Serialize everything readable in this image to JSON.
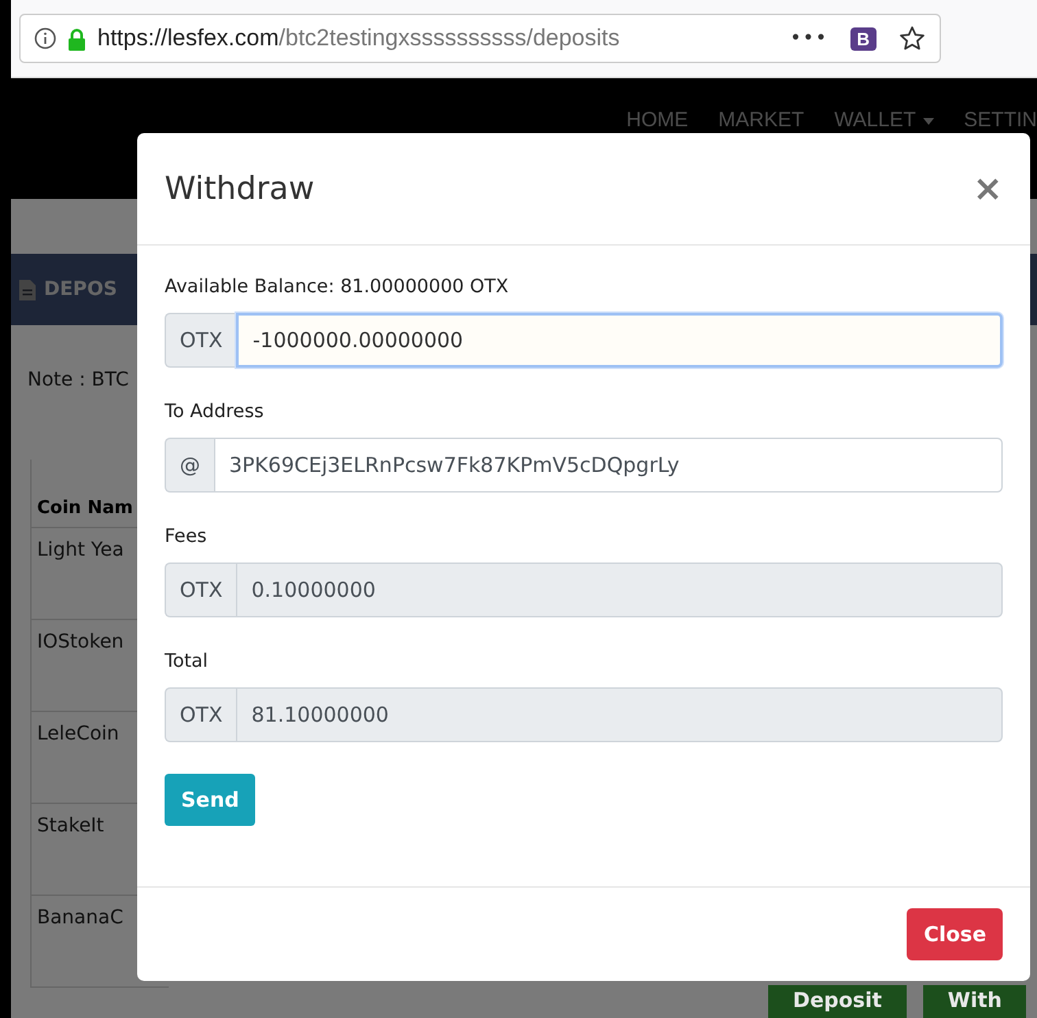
{
  "browser": {
    "url_host": "https://lesfex.com",
    "url_path": "/btc2testingxssssssssss/deposits",
    "more": "•••",
    "extension": "B"
  },
  "nav": [
    {
      "label": "HOME",
      "dropdown": false
    },
    {
      "label": "MARKET",
      "dropdown": false
    },
    {
      "label": "WALLET",
      "dropdown": true
    },
    {
      "label": "SETTIN",
      "dropdown": false
    }
  ],
  "page": {
    "section_title": "DEPOS",
    "note": "Note : BTC",
    "table": {
      "header": "Coin Nam",
      "rows": [
        "Light Yea",
        "IOStoken",
        "LeleCoin",
        "StakeIt",
        "BananaC"
      ]
    },
    "row_buttons": [
      "Deposit",
      "With"
    ]
  },
  "modal": {
    "title": "Withdraw",
    "close_icon": "×",
    "fields": [
      {
        "label": "Available Balance: 81.00000000 OTX",
        "addon": "OTX",
        "value": "-1000000.00000000",
        "focused": true,
        "readonly": false
      },
      {
        "label": "To Address",
        "addon": "@",
        "value": "3PK69CEj3ELRnPcsw7Fk87KPmV5cDQpgrLy",
        "focused": false,
        "readonly": false
      },
      {
        "label": "Fees",
        "addon": "OTX",
        "value": "0.10000000",
        "focused": false,
        "readonly": true
      },
      {
        "label": "Total",
        "addon": "OTX",
        "value": "81.10000000",
        "focused": false,
        "readonly": true
      }
    ],
    "send": "Send",
    "close": "Close"
  }
}
